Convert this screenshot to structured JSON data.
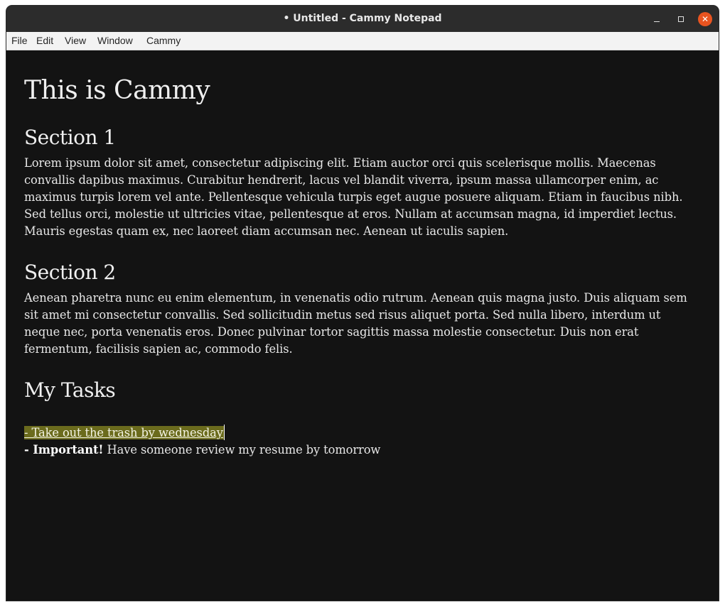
{
  "window": {
    "title": "• Untitled - Cammy Notepad",
    "controls": {
      "minimize_icon": "minimize-icon",
      "maximize_icon": "maximize-icon",
      "close_icon": "close-icon",
      "close_glyph": "✕"
    },
    "colors": {
      "background": "#131313",
      "titlebar": "#2c2c2c",
      "close_button": "#e95420",
      "highlight": "#6b6b1d"
    }
  },
  "menu": {
    "items": [
      "File",
      "Edit",
      "View",
      "Window",
      "Cammy"
    ]
  },
  "document": {
    "title": "This is Cammy",
    "sections": [
      {
        "heading": "Section 1",
        "body": "Lorem ipsum dolor sit amet, consectetur adipiscing elit. Etiam auctor orci quis scelerisque mollis. Maecenas convallis dapibus maximus. Curabitur hendrerit, lacus vel blandit viverra, ipsum massa ullamcorper enim, ac maximus turpis lorem vel ante. Pellentesque vehicula turpis eget augue posuere aliquam. Etiam in faucibus nibh. Sed tellus orci, molestie ut ultricies vitae, pellentesque at eros. Nullam at accumsan magna, id imperdiet lectus. Mauris egestas quam ex, nec laoreet diam accumsan nec. Aenean ut iaculis sapien."
      },
      {
        "heading": "Section 2",
        "body": "Aenean pharetra nunc eu enim elementum, in venenatis odio rutrum. Aenean quis magna justo. Duis aliquam sem sit amet mi consectetur convallis. Sed sollicitudin metus sed risus aliquet porta. Sed nulla libero, interdum ut neque nec, porta venenatis eros. Donec pulvinar tortor sagittis massa molestie consectetur. Duis non erat fermentum, facilisis sapien ac, commodo felis."
      }
    ],
    "tasks": {
      "heading": "My Tasks",
      "items": [
        {
          "text": "- Take out the trash by wednesday"
        },
        {
          "prefix": "- Important!",
          "text": " Have someone review my resume by tomorrow"
        }
      ]
    }
  }
}
